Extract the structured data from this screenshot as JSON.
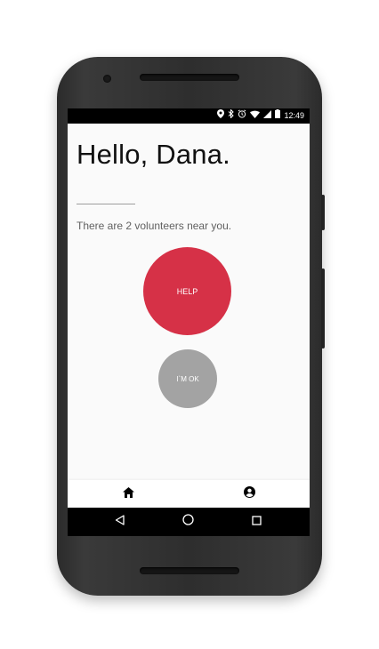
{
  "status_bar": {
    "time": "12:49",
    "icons": [
      "location-icon",
      "bluetooth-icon",
      "alarm-icon",
      "wifi-icon",
      "signal-icon",
      "battery-icon"
    ]
  },
  "main": {
    "greeting": "Hello, Dana.",
    "volunteers_text": "There are 2 volunteers near you."
  },
  "buttons": {
    "help_label": "HELP",
    "ok_label": "I`M OK"
  },
  "bottom_nav": {
    "items": [
      {
        "name": "home",
        "icon": "home-icon"
      },
      {
        "name": "profile",
        "icon": "account-circle-icon"
      }
    ]
  },
  "system_nav": {
    "buttons": [
      "back-icon",
      "home-circle-icon",
      "recents-icon"
    ]
  },
  "colors": {
    "help_button": "#d63147",
    "ok_button": "#a3a3a3",
    "screen_background": "#fafafa"
  }
}
